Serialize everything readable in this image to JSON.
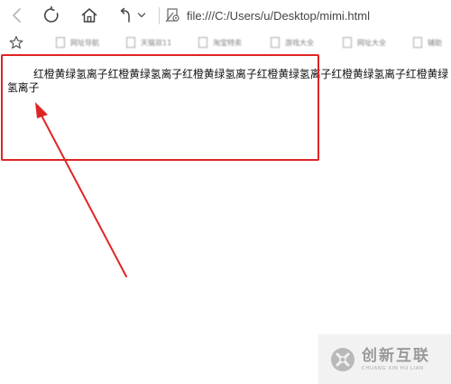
{
  "toolbar": {
    "back_icon": "back-arrow-icon",
    "reload_icon": "reload-icon",
    "home_icon": "home-icon",
    "undo_icon": "undo-icon",
    "undo_dropdown_icon": "chevron-down-icon",
    "address_icon": "page-gear-icon",
    "address": "file:///C:/Users/u/Desktop/mimi.html"
  },
  "bookmarks": {
    "favorites_icon": "star-icon",
    "items": [
      {
        "label": "网址导航"
      },
      {
        "label": "天猫双11"
      },
      {
        "label": "淘宝特卖"
      },
      {
        "label": "游戏大全"
      },
      {
        "label": "网址大全"
      },
      {
        "label": "辅助"
      }
    ]
  },
  "page": {
    "text": "红橙黄绿氢离子红橙黄绿氢离子红橙黄绿氢离子红橙黄绿氢离子红橙黄绿氢离子红橙黄绿氢离子",
    "annotation_color": "#e02424"
  },
  "watermark": {
    "logo_icon": "chuangxin-logo-icon",
    "name": "创新互联",
    "pinyin": "CHUANG XIN HU LIAN"
  }
}
